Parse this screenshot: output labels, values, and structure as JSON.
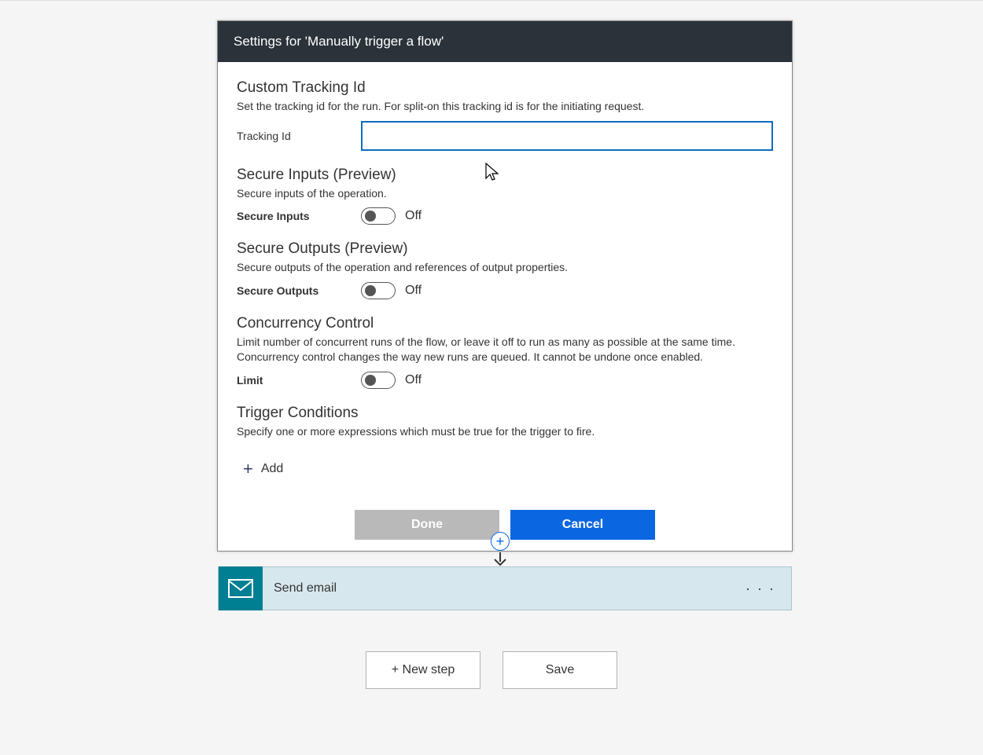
{
  "panel": {
    "header": "Settings for 'Manually trigger a flow'",
    "tracking": {
      "title": "Custom Tracking Id",
      "desc": "Set the tracking id for the run. For split-on this tracking id is for the initiating request.",
      "label": "Tracking Id",
      "value": ""
    },
    "secureInputs": {
      "title": "Secure Inputs (Preview)",
      "desc": "Secure inputs of the operation.",
      "label": "Secure Inputs",
      "state": "Off"
    },
    "secureOutputs": {
      "title": "Secure Outputs (Preview)",
      "desc": "Secure outputs of the operation and references of output properties.",
      "label": "Secure Outputs",
      "state": "Off"
    },
    "concurrency": {
      "title": "Concurrency Control",
      "desc": "Limit number of concurrent runs of the flow, or leave it off to run as many as possible at the same time. Concurrency control changes the way new runs are queued. It cannot be undone once enabled.",
      "label": "Limit",
      "state": "Off"
    },
    "triggerConditions": {
      "title": "Trigger Conditions",
      "desc": "Specify one or more expressions which must be true for the trigger to fire.",
      "addLabel": "Add"
    },
    "buttons": {
      "done": "Done",
      "cancel": "Cancel"
    }
  },
  "action": {
    "title": "Send email"
  },
  "bottom": {
    "newStep": "+ New step",
    "save": "Save"
  }
}
